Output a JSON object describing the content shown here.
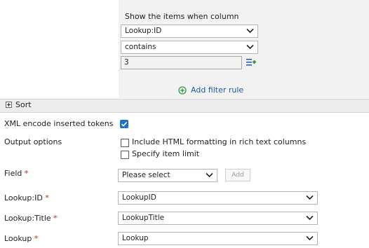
{
  "filter": {
    "title": "Show the items when column",
    "column_select": "Lookup:ID",
    "operator_select": "contains",
    "value_input": "3",
    "add_rule_label": "Add filter rule"
  },
  "sort": {
    "label": "Sort"
  },
  "xml_encode": {
    "label": "XML encode inserted tokens",
    "checked": true
  },
  "output": {
    "label": "Output options",
    "option1": "Include HTML formatting in rich text columns",
    "option2": "Specify item limit"
  },
  "field": {
    "label": "Field",
    "required_mark": "*",
    "select": "Please select",
    "add_button": "Add"
  },
  "mappings": [
    {
      "label": "Lookup:ID",
      "required_mark": "*",
      "value": "LookupID"
    },
    {
      "label": "Lookup:Title",
      "required_mark": "*",
      "value": "LookupTitle"
    },
    {
      "label": "Lookup",
      "required_mark": "*",
      "value": "Lookup"
    }
  ],
  "colors": {
    "accent": "#1a73c8",
    "link": "#1a5aa8",
    "required": "#c42b1c",
    "add_icon": "#2e9c3a"
  },
  "icons": [
    "chevron-down-icon",
    "add-circle-icon",
    "insert-token-icon",
    "expand-plus-icon",
    "checkmark-icon"
  ]
}
